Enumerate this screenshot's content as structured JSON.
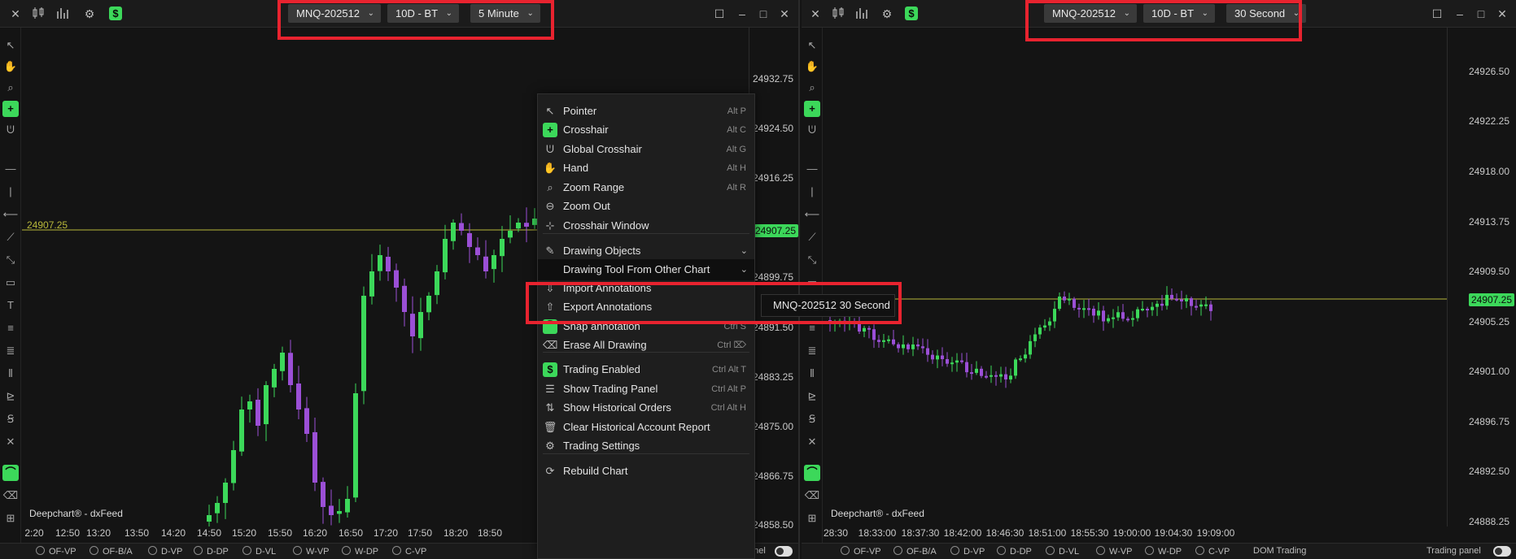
{
  "left_chart": {
    "symbol": "MNQ-202512",
    "range": "10D - BT",
    "interval": "5 Minute",
    "watermark": "Deepchart® - dxFeed",
    "current_price": "24907.25",
    "line_price": "24907.25",
    "price_ticks": [
      "24932.75",
      "24924.50",
      "24916.25",
      "24899.75",
      "24891.50",
      "24883.25",
      "24875.00",
      "24866.75",
      "24858.50"
    ],
    "time_ticks": [
      "2:20",
      "12:50",
      "13:20",
      "13:50",
      "14:20",
      "14:50",
      "15:20",
      "15:50",
      "16:20",
      "16:50",
      "17:20",
      "17:50",
      "18:20",
      "18:50"
    ],
    "bottom_options": [
      "OF-VP",
      "OF-B/A",
      "D-VP",
      "D-DP",
      "D-VL",
      "W-VP",
      "W-DP",
      "C-VP"
    ],
    "bottom_right_label": "anel"
  },
  "right_chart": {
    "symbol": "MNQ-202512",
    "range": "10D - BT",
    "interval": "30 Second",
    "watermark": "Deepchart® - dxFeed",
    "current_price": "24907.25",
    "price_ticks": [
      "24926.50",
      "24922.25",
      "24918.00",
      "24913.75",
      "24909.50",
      "24905.25",
      "24901.00",
      "24896.75",
      "24892.50",
      "24888.25"
    ],
    "time_ticks": [
      "28:30",
      "18:33:00",
      "18:37:30",
      "18:42:00",
      "18:46:30",
      "18:51:00",
      "18:55:30",
      "19:00:00",
      "19:04:30",
      "19:09:00"
    ],
    "bottom_options": [
      "OF-VP",
      "OF-B/A",
      "D-VP",
      "D-DP",
      "D-VL",
      "W-VP",
      "W-DP",
      "C-VP"
    ],
    "dom_trading": "DOM Trading",
    "trading_panel": "Trading panel"
  },
  "context_menu": {
    "items": [
      {
        "label": "Pointer",
        "shortcut": "Alt P",
        "icon": "pointer-icon"
      },
      {
        "label": "Crosshair",
        "shortcut": "Alt C",
        "icon": "crosshair-icon"
      },
      {
        "label": "Global Crosshair",
        "shortcut": "Alt G",
        "icon": "global-crosshair-icon"
      },
      {
        "label": "Hand",
        "shortcut": "Alt H",
        "icon": "hand-icon"
      },
      {
        "label": "Zoom Range",
        "shortcut": "Alt R",
        "icon": "zoom-range-icon"
      },
      {
        "label": "Zoom Out",
        "shortcut": "",
        "icon": "zoom-out-icon"
      },
      {
        "label": "Crosshair Window",
        "shortcut": "",
        "icon": "crosshair-window-icon"
      },
      {
        "label": "Drawing Objects",
        "shortcut": "",
        "icon": "pencil-icon"
      },
      {
        "label": "Drawing Tool From Other Chart",
        "shortcut": "",
        "icon": ""
      },
      {
        "label": "Import Annotations",
        "shortcut": "",
        "icon": "import-icon"
      },
      {
        "label": "Export Annotations",
        "shortcut": "",
        "icon": "export-icon"
      },
      {
        "label": "Snap annotation",
        "shortcut": "Ctrl S",
        "icon": "magnet-icon"
      },
      {
        "label": "Erase All Drawing",
        "shortcut": "Ctrl ⌦",
        "icon": "eraser-icon"
      },
      {
        "label": "Trading Enabled",
        "shortcut": "Ctrl Alt T",
        "icon": "dollar-icon"
      },
      {
        "label": "Show Trading Panel",
        "shortcut": "Ctrl Alt P",
        "icon": "panel-icon"
      },
      {
        "label": "Show Historical Orders",
        "shortcut": "Ctrl Alt H",
        "icon": "orders-icon"
      },
      {
        "label": "Clear Historical Account Report",
        "shortcut": "",
        "icon": "trash-icon"
      },
      {
        "label": "Trading Settings",
        "shortcut": "",
        "icon": "gear-icon"
      },
      {
        "label": "Rebuild Chart",
        "shortcut": "",
        "icon": "rebuild-icon"
      }
    ],
    "submenu_item": "MNQ-202512 30 Second"
  },
  "colors": {
    "bull": "#3cd85a",
    "bear": "#9b4fd6",
    "price_line": "#b8b83a",
    "highlight_box": "#e8232f"
  }
}
